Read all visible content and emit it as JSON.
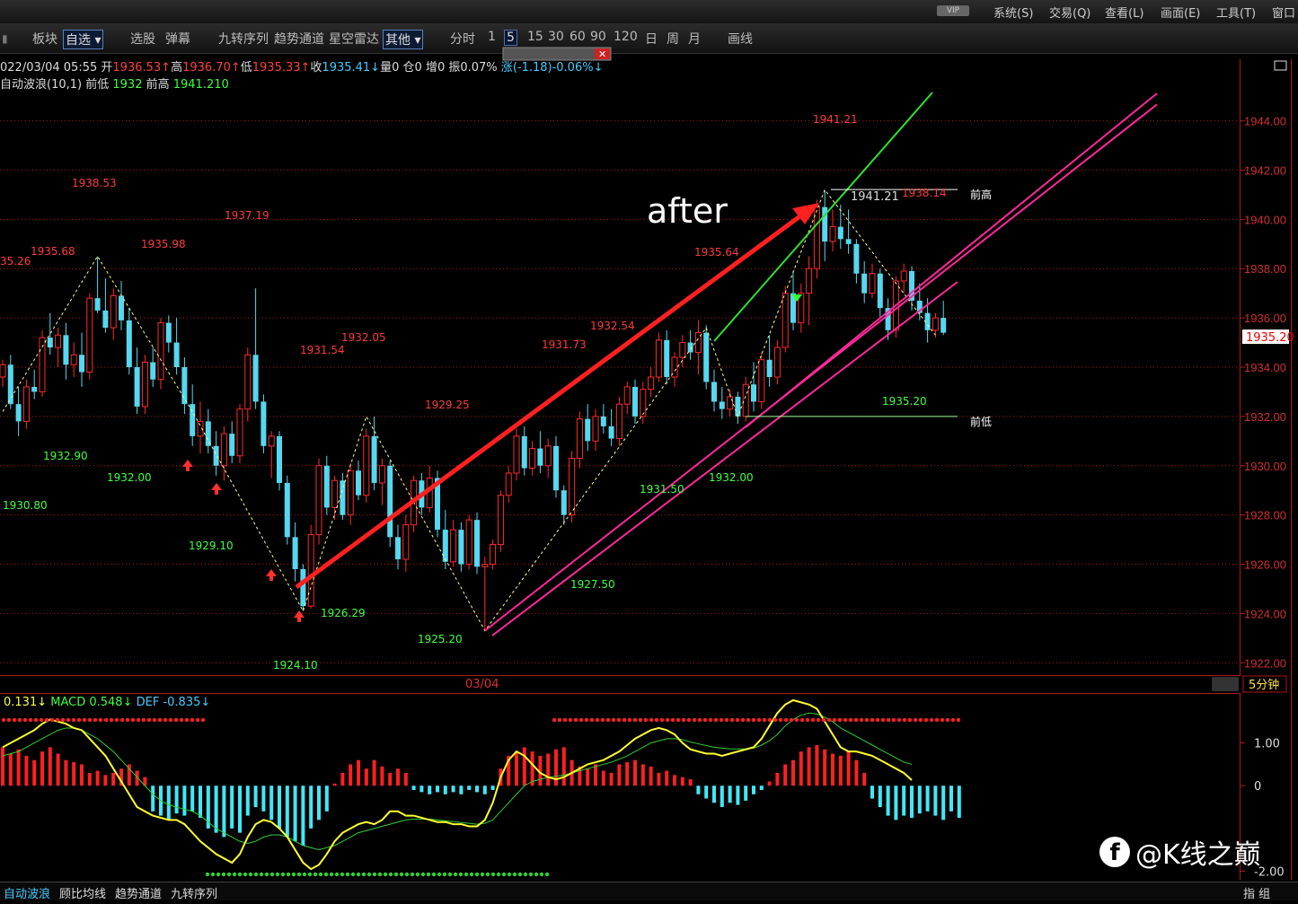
{
  "menu": [
    "系统(S)",
    "交易(Q)",
    "查看(L)",
    "画面(E)",
    "工具(T)",
    "窗口"
  ],
  "vip_badge": "VIP",
  "toolbar": {
    "items": [
      "板块",
      "自选",
      "选股",
      "弹幕",
      "九转序列",
      "趋势通道",
      "星空雷达",
      "其他",
      "分时",
      "1",
      "5",
      "15",
      "30",
      "60",
      "90",
      "120",
      "日",
      "周",
      "月",
      "画线"
    ],
    "selected_watchlist": "自选",
    "selected_other": "其他",
    "selected_period": "5"
  },
  "info": {
    "date_time": "022/03/04 05:55",
    "open_label": "开",
    "open": "1936.53↑",
    "high_label": "高",
    "high": "1936.70↑",
    "low_label": "低",
    "low": "1935.33↑",
    "close_label": "收",
    "close": "1935.41↓",
    "volume_label": "量",
    "volume": "0",
    "position_label": "仓",
    "position": "0",
    "add_label": "增",
    "add": "0",
    "amplitude_label": "振",
    "amplitude": "0.07%",
    "change_label": "涨",
    "change": "(-1.18)-0.06%↓"
  },
  "indicator": {
    "name": "自动波浪(10,1)",
    "prev_low_label": "前低",
    "prev_low": "1932",
    "prev_high_label": "前高",
    "prev_high": "1941.210"
  },
  "annotation_text": "after",
  "hline_labels": {
    "high": "前高",
    "low": "前低"
  },
  "current_price_tag": "1935.20",
  "x_axis_label": "03/04",
  "period_label": "5分钟",
  "macd_header": {
    "diff": "0.131↓",
    "macd_label": "MACD",
    "macd": "0.548↓",
    "def_label": "DEF",
    "def": "-0.835↓"
  },
  "bottom_tabs": [
    "自动波浪",
    "顾比均线",
    "趋势通道",
    "九转序列"
  ],
  "bottom_right": "指 组",
  "watermark": "@K线之巅",
  "colors": {
    "up": "#ff2a2a",
    "down": "#55d8f0",
    "axis": "#b01818",
    "wave_high": "#ff3030",
    "wave_low": "#30ff30",
    "channel_pink": "#ff2a9a",
    "channel_green": "#30e030",
    "arrow": "#ff2020",
    "macd_yellow": "#ffff30",
    "macd_green": "#30d030"
  },
  "chart_data": {
    "type": "candlestick",
    "ylim": [
      1921.5,
      1946.5
    ],
    "yticks": [
      "1944.00",
      "1942.00",
      "1940.00",
      "1938.00",
      "1936.00",
      "1934.00",
      "1932.00",
      "1930.00",
      "1928.00",
      "1926.00",
      "1924.00",
      "1922.00"
    ],
    "candles": [
      [
        1933.6,
        1934.3,
        1933.2,
        1934.1
      ],
      [
        1934.1,
        1934.5,
        1932.3,
        1932.5
      ],
      [
        1932.5,
        1933.2,
        1931.2,
        1931.8
      ],
      [
        1931.8,
        1933.5,
        1931.5,
        1933.2
      ],
      [
        1933.2,
        1933.9,
        1932.7,
        1933.0
      ],
      [
        1933.0,
        1935.5,
        1932.8,
        1935.2
      ],
      [
        1935.2,
        1936.2,
        1934.5,
        1934.8
      ],
      [
        1934.8,
        1935.6,
        1934.0,
        1935.3
      ],
      [
        1935.3,
        1935.8,
        1933.5,
        1934.1
      ],
      [
        1934.1,
        1935.0,
        1933.6,
        1934.5
      ],
      [
        1934.5,
        1935.4,
        1933.2,
        1933.8
      ],
      [
        1933.8,
        1937.0,
        1933.5,
        1936.8
      ],
      [
        1936.8,
        1938.5,
        1936.2,
        1936.3
      ],
      [
        1936.3,
        1937.6,
        1935.4,
        1935.6
      ],
      [
        1935.6,
        1937.2,
        1935.1,
        1936.9
      ],
      [
        1936.9,
        1937.5,
        1935.5,
        1935.9
      ],
      [
        1935.9,
        1936.4,
        1933.7,
        1934.0
      ],
      [
        1934.0,
        1934.8,
        1932.1,
        1932.4
      ],
      [
        1932.4,
        1934.5,
        1932.1,
        1934.2
      ],
      [
        1934.2,
        1934.8,
        1933.2,
        1933.5
      ],
      [
        1933.5,
        1936.0,
        1933.1,
        1935.8
      ],
      [
        1935.8,
        1936.1,
        1934.6,
        1935.0
      ],
      [
        1935.0,
        1936.0,
        1933.7,
        1934.0
      ],
      [
        1934.0,
        1934.4,
        1932.1,
        1932.5
      ],
      [
        1932.5,
        1933.3,
        1930.8,
        1931.2
      ],
      [
        1931.2,
        1932.6,
        1930.5,
        1931.8
      ],
      [
        1931.8,
        1932.3,
        1930.5,
        1930.8
      ],
      [
        1930.8,
        1931.4,
        1929.6,
        1930.0
      ],
      [
        1930.0,
        1931.6,
        1929.4,
        1931.3
      ],
      [
        1931.3,
        1931.8,
        1930.1,
        1930.4
      ],
      [
        1930.4,
        1932.5,
        1930.1,
        1932.3
      ],
      [
        1932.3,
        1934.8,
        1931.8,
        1934.5
      ],
      [
        1934.5,
        1937.2,
        1932.3,
        1932.6
      ],
      [
        1932.6,
        1932.9,
        1930.5,
        1930.8
      ],
      [
        1930.8,
        1931.4,
        1929.5,
        1931.2
      ],
      [
        1931.2,
        1931.4,
        1929.0,
        1929.3
      ],
      [
        1929.3,
        1929.6,
        1926.8,
        1927.1
      ],
      [
        1927.1,
        1927.7,
        1925.3,
        1925.8
      ],
      [
        1925.8,
        1926.0,
        1924.1,
        1924.3
      ],
      [
        1924.3,
        1927.6,
        1924.2,
        1927.2
      ],
      [
        1927.2,
        1930.3,
        1926.8,
        1930.0
      ],
      [
        1930.0,
        1930.4,
        1928.0,
        1928.3
      ],
      [
        1928.3,
        1929.6,
        1927.8,
        1929.4
      ],
      [
        1929.4,
        1929.7,
        1927.8,
        1928.0
      ],
      [
        1928.0,
        1930.1,
        1927.6,
        1929.8
      ],
      [
        1929.8,
        1930.2,
        1928.6,
        1928.8
      ],
      [
        1928.8,
        1931.5,
        1928.5,
        1931.2
      ],
      [
        1931.2,
        1932.0,
        1929.0,
        1929.3
      ],
      [
        1929.3,
        1930.3,
        1928.4,
        1930.0
      ],
      [
        1930.0,
        1930.2,
        1926.7,
        1927.1
      ],
      [
        1927.1,
        1927.6,
        1925.8,
        1926.2
      ],
      [
        1926.2,
        1928.0,
        1925.7,
        1927.6
      ],
      [
        1927.6,
        1929.6,
        1927.3,
        1929.4
      ],
      [
        1929.4,
        1929.7,
        1928.0,
        1928.3
      ],
      [
        1928.3,
        1930.0,
        1928.1,
        1929.5
      ],
      [
        1929.5,
        1929.8,
        1927.1,
        1927.4
      ],
      [
        1927.4,
        1928.2,
        1925.8,
        1926.1
      ],
      [
        1926.1,
        1927.8,
        1925.9,
        1927.4
      ],
      [
        1927.4,
        1927.7,
        1925.7,
        1926.0
      ],
      [
        1926.0,
        1928.0,
        1925.8,
        1927.8
      ],
      [
        1927.8,
        1928.1,
        1925.6,
        1925.9
      ],
      [
        1925.9,
        1926.3,
        1923.3,
        1926.0
      ],
      [
        1926.0,
        1927.0,
        1925.8,
        1926.8
      ],
      [
        1926.8,
        1929.0,
        1926.5,
        1928.8
      ],
      [
        1928.8,
        1930.0,
        1928.5,
        1929.7
      ],
      [
        1929.7,
        1931.5,
        1929.4,
        1931.2
      ],
      [
        1931.2,
        1931.6,
        1929.6,
        1929.9
      ],
      [
        1929.9,
        1931.0,
        1929.6,
        1930.7
      ],
      [
        1930.7,
        1931.4,
        1929.7,
        1930.0
      ],
      [
        1930.0,
        1931.1,
        1929.5,
        1930.8
      ],
      [
        1930.8,
        1931.2,
        1928.7,
        1929.0
      ],
      [
        1929.0,
        1929.2,
        1927.6,
        1928.0
      ],
      [
        1928.0,
        1930.6,
        1927.7,
        1930.3
      ],
      [
        1930.3,
        1932.2,
        1929.9,
        1931.9
      ],
      [
        1931.9,
        1932.5,
        1930.6,
        1931.0
      ],
      [
        1931.0,
        1932.3,
        1930.6,
        1932.0
      ],
      [
        1932.0,
        1932.5,
        1931.3,
        1931.6
      ],
      [
        1931.6,
        1932.3,
        1930.8,
        1931.1
      ],
      [
        1931.1,
        1932.8,
        1930.8,
        1932.5
      ],
      [
        1932.5,
        1933.4,
        1932.1,
        1933.2
      ],
      [
        1933.2,
        1933.5,
        1931.7,
        1932.0
      ],
      [
        1932.0,
        1933.4,
        1931.7,
        1933.1
      ],
      [
        1933.1,
        1934.0,
        1932.8,
        1933.6
      ],
      [
        1933.6,
        1935.4,
        1933.4,
        1935.1
      ],
      [
        1935.1,
        1935.5,
        1933.3,
        1933.6
      ],
      [
        1933.6,
        1934.6,
        1933.2,
        1934.4
      ],
      [
        1934.4,
        1935.3,
        1934.0,
        1935.0
      ],
      [
        1935.0,
        1935.5,
        1934.3,
        1934.6
      ],
      [
        1934.6,
        1935.9,
        1933.7,
        1935.4
      ],
      [
        1935.4,
        1935.7,
        1933.1,
        1933.4
      ],
      [
        1933.4,
        1933.9,
        1932.2,
        1932.6
      ],
      [
        1932.6,
        1933.2,
        1931.9,
        1932.3
      ],
      [
        1932.3,
        1933.1,
        1932.0,
        1932.8
      ],
      [
        1932.8,
        1933.0,
        1931.7,
        1932.0
      ],
      [
        1932.0,
        1933.6,
        1931.8,
        1933.3
      ],
      [
        1933.3,
        1934.2,
        1932.2,
        1932.6
      ],
      [
        1932.6,
        1934.6,
        1932.3,
        1934.3
      ],
      [
        1934.3,
        1935.3,
        1933.2,
        1933.6
      ],
      [
        1933.6,
        1935.1,
        1933.3,
        1934.8
      ],
      [
        1934.8,
        1937.3,
        1934.6,
        1937.0
      ],
      [
        1937.0,
        1937.9,
        1935.5,
        1935.8
      ],
      [
        1935.8,
        1937.4,
        1935.4,
        1937.0
      ],
      [
        1937.0,
        1938.5,
        1935.7,
        1938.0
      ],
      [
        1938.0,
        1940.8,
        1937.6,
        1940.5
      ],
      [
        1940.5,
        1941.2,
        1938.3,
        1939.1
      ],
      [
        1939.1,
        1940.4,
        1938.7,
        1939.7
      ],
      [
        1939.7,
        1940.6,
        1938.8,
        1939.2
      ],
      [
        1939.2,
        1940.4,
        1938.6,
        1939.0
      ],
      [
        1939.0,
        1939.2,
        1937.4,
        1937.8
      ],
      [
        1937.8,
        1938.3,
        1936.6,
        1937.0
      ],
      [
        1937.0,
        1938.2,
        1936.8,
        1937.8
      ],
      [
        1937.8,
        1938.0,
        1936.0,
        1936.4
      ],
      [
        1936.4,
        1936.8,
        1935.1,
        1935.5
      ],
      [
        1935.5,
        1937.7,
        1935.2,
        1937.5
      ],
      [
        1937.5,
        1938.2,
        1937.0,
        1937.9
      ],
      [
        1937.9,
        1938.1,
        1936.3,
        1936.7
      ],
      [
        1936.7,
        1937.4,
        1935.9,
        1936.2
      ],
      [
        1936.2,
        1936.8,
        1935.0,
        1935.5
      ],
      [
        1935.5,
        1936.2,
        1935.2,
        1936.0
      ],
      [
        1936.0,
        1936.7,
        1935.3,
        1935.4
      ]
    ],
    "wave_labels_high": [
      "35.26",
      "1935.68",
      "1938.53",
      "1935.98",
      "1937.19",
      "1931.54",
      "1932.05",
      "1929.25",
      "1931.73",
      "1932.54",
      "1935.64",
      "1941.21",
      "1938.14"
    ],
    "wave_labels_low": [
      "1930.80",
      "1932.90",
      "1932.00",
      "1929.10",
      "1924.10",
      "1926.29",
      "1925.20",
      "1927.50",
      "1931.50",
      "1932.00",
      "1935.20"
    ],
    "pivot_high_label": "1941.21",
    "zigzag": [
      [
        1932.2,
        0
      ],
      [
        1938.5,
        12
      ],
      [
        1932.2,
        24
      ],
      [
        1924.1,
        38
      ],
      [
        1932.0,
        46
      ],
      [
        1923.3,
        61
      ],
      [
        1935.6,
        89
      ],
      [
        1932.0,
        93
      ],
      [
        1941.2,
        104
      ],
      [
        1935.3,
        118
      ]
    ],
    "macd": {
      "ylim": [
        -2.2,
        2.0
      ],
      "yticks": [
        "1.00",
        "0",
        "-2.00"
      ],
      "hist": [
        0.9,
        0.75,
        0.85,
        0.7,
        0.6,
        0.8,
        0.9,
        0.75,
        0.6,
        0.55,
        0.5,
        0.3,
        0.35,
        0.25,
        0.3,
        0.4,
        0.5,
        0.35,
        0.2,
        -0.6,
        -0.7,
        -0.8,
        -0.65,
        -0.7,
        -0.6,
        -0.75,
        -1.0,
        -1.1,
        -1.2,
        -1.0,
        -1.1,
        -0.7,
        -0.5,
        -0.6,
        -0.8,
        -1.0,
        -1.2,
        -1.3,
        -1.4,
        -1.0,
        -0.8,
        -0.6,
        0.05,
        0.3,
        0.5,
        0.6,
        0.4,
        0.6,
        0.45,
        0.3,
        0.4,
        0.3,
        -0.1,
        -0.15,
        -0.2,
        -0.15,
        -0.2,
        -0.15,
        -0.2,
        -0.1,
        -0.15,
        -0.2,
        -0.1,
        0.4,
        0.7,
        0.8,
        0.9,
        0.8,
        0.7,
        0.75,
        0.85,
        0.9,
        0.6,
        0.45,
        0.4,
        0.5,
        0.35,
        0.3,
        0.5,
        0.55,
        0.6,
        0.5,
        0.45,
        0.3,
        0.35,
        0.25,
        0.2,
        0.15,
        -0.2,
        -0.3,
        -0.4,
        -0.5,
        -0.4,
        -0.45,
        -0.35,
        -0.2,
        -0.1,
        0.1,
        0.3,
        0.5,
        0.6,
        0.8,
        0.9,
        0.95,
        0.85,
        0.75,
        0.7,
        0.8,
        0.6,
        0.3,
        -0.3,
        -0.5,
        -0.7,
        -0.8,
        -0.7,
        -0.75,
        -0.65,
        -0.6,
        -0.7,
        -0.8,
        -0.6,
        -0.75
      ],
      "diff": [
        0.9,
        1.0,
        1.1,
        1.2,
        1.3,
        1.45,
        1.55,
        1.5,
        1.45,
        1.35,
        1.3,
        1.1,
        0.9,
        0.7,
        0.4,
        0.1,
        -0.2,
        -0.5,
        -0.6,
        -0.7,
        -0.75,
        -0.8,
        -0.8,
        -0.9,
        -1.1,
        -1.3,
        -1.45,
        -1.6,
        -1.7,
        -1.8,
        -1.6,
        -1.2,
        -0.9,
        -0.8,
        -0.85,
        -1.0,
        -1.2,
        -1.5,
        -1.8,
        -1.95,
        -1.85,
        -1.6,
        -1.3,
        -1.1,
        -1.0,
        -0.9,
        -0.85,
        -0.9,
        -0.8,
        -0.6,
        -0.6,
        -0.7,
        -0.7,
        -0.75,
        -0.8,
        -0.85,
        -0.85,
        -0.9,
        -0.9,
        -0.95,
        -0.95,
        -0.8,
        -0.4,
        0.2,
        0.6,
        0.8,
        0.7,
        0.5,
        0.3,
        0.2,
        0.15,
        0.2,
        0.3,
        0.4,
        0.5,
        0.55,
        0.6,
        0.7,
        0.8,
        0.95,
        1.1,
        1.2,
        1.3,
        1.35,
        1.3,
        1.2,
        1.0,
        0.85,
        0.8,
        0.75,
        0.75,
        0.7,
        0.75,
        0.8,
        0.85,
        0.9,
        1.1,
        1.4,
        1.7,
        1.9,
        2.0,
        1.95,
        1.9,
        1.8,
        1.5,
        1.2,
        0.9,
        0.8,
        0.8,
        0.75,
        0.7,
        0.6,
        0.5,
        0.4,
        0.3,
        0.131
      ],
      "dea": [
        0.7,
        0.75,
        0.8,
        0.9,
        1.0,
        1.1,
        1.2,
        1.3,
        1.35,
        1.35,
        1.3,
        1.2,
        1.1,
        0.95,
        0.8,
        0.6,
        0.4,
        0.2,
        0.0,
        -0.2,
        -0.35,
        -0.45,
        -0.5,
        -0.55,
        -0.6,
        -0.7,
        -0.85,
        -1.0,
        -1.1,
        -1.2,
        -1.3,
        -1.35,
        -1.3,
        -1.2,
        -1.15,
        -1.15,
        -1.2,
        -1.3,
        -1.4,
        -1.45,
        -1.5,
        -1.45,
        -1.4,
        -1.3,
        -1.2,
        -1.1,
        -1.05,
        -1.0,
        -0.95,
        -0.9,
        -0.85,
        -0.8,
        -0.78,
        -0.78,
        -0.78,
        -0.8,
        -0.82,
        -0.84,
        -0.86,
        -0.88,
        -0.9,
        -0.88,
        -0.8,
        -0.6,
        -0.4,
        -0.2,
        0.0,
        0.1,
        0.15,
        0.2,
        0.22,
        0.25,
        0.3,
        0.35,
        0.4,
        0.45,
        0.5,
        0.55,
        0.62,
        0.7,
        0.8,
        0.9,
        1.0,
        1.05,
        1.1,
        1.1,
        1.08,
        1.02,
        0.98,
        0.94,
        0.9,
        0.88,
        0.86,
        0.86,
        0.86,
        0.88,
        0.95,
        1.05,
        1.2,
        1.4,
        1.55,
        1.65,
        1.7,
        1.68,
        1.6,
        1.5,
        1.35,
        1.25,
        1.15,
        1.05,
        0.95,
        0.85,
        0.75,
        0.65,
        0.55,
        0.5
      ]
    }
  }
}
